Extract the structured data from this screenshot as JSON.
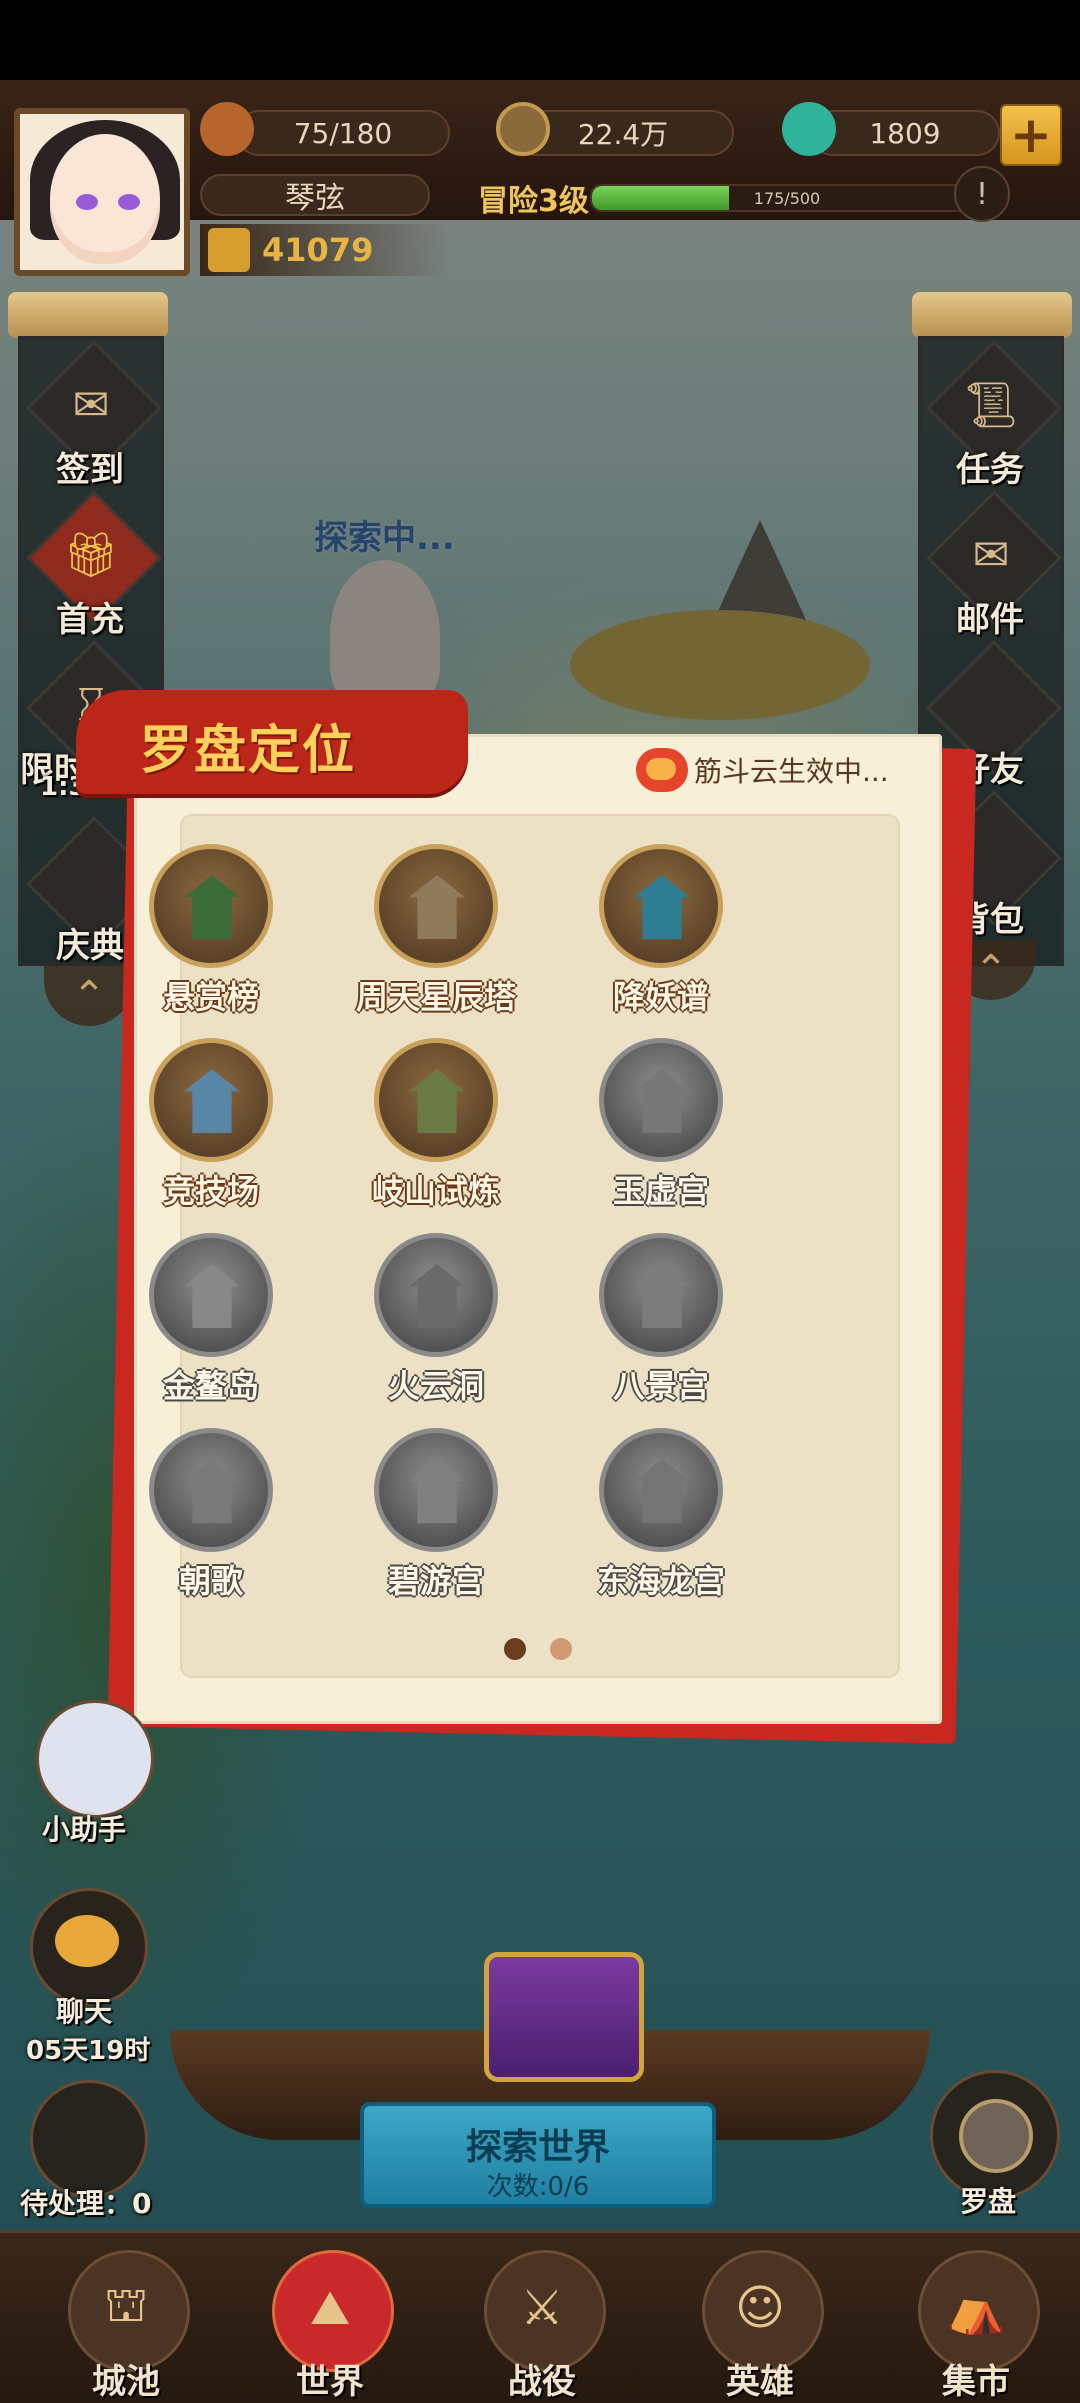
{
  "hud": {
    "stamina": "75/180",
    "coins": "22.4万",
    "gems": "1809",
    "player_name": "琴弦",
    "adventure_level": "冒险3级",
    "xp_text": "175/500",
    "xp_fraction": 0.35,
    "power": "41079"
  },
  "left_menu": [
    {
      "label": "签到"
    },
    {
      "label": "首充"
    },
    {
      "label": "限时",
      "timer": "1:33:"
    },
    {
      "label": "庆典"
    }
  ],
  "right_menu": [
    {
      "label": "任务"
    },
    {
      "label": "邮件"
    },
    {
      "label": "好友"
    },
    {
      "label": "背包"
    }
  ],
  "exploring_status": "探索中...",
  "compass_modal": {
    "title": "罗盘定位",
    "buff": "筋斗云生效中...",
    "locations": [
      {
        "label": "悬赏榜",
        "locked": false
      },
      {
        "label": "周天星辰塔",
        "locked": false
      },
      {
        "label": "降妖谱",
        "locked": false
      },
      {
        "label": "竞技场",
        "locked": false
      },
      {
        "label": "岐山试炼",
        "locked": false
      },
      {
        "label": "玉虚宫",
        "locked": true
      },
      {
        "label": "金鳌岛",
        "locked": true
      },
      {
        "label": "火云洞",
        "locked": true
      },
      {
        "label": "八景宫",
        "locked": true
      },
      {
        "label": "朝歌",
        "locked": true
      },
      {
        "label": "碧游宫",
        "locked": true
      },
      {
        "label": "东海龙宫",
        "locked": true
      }
    ],
    "page_count": 2,
    "current_page": 1
  },
  "lower_left": {
    "helper_label": "小助手",
    "chat_label": "聊天",
    "timer": "05天19时",
    "pending_label": "待处理：0"
  },
  "explore_button": {
    "title": "探索世界",
    "count": "次数:0/6"
  },
  "compass_button_label": "罗盘",
  "bottom_nav": [
    {
      "label": "城池",
      "active": false
    },
    {
      "label": "世界",
      "active": true
    },
    {
      "label": "战役",
      "active": false
    },
    {
      "label": "英雄",
      "active": false
    },
    {
      "label": "集市",
      "active": false
    }
  ],
  "colors": {
    "accent_red": "#c8281f",
    "title_gold": "#ffd15a",
    "explore_blue": "#2a93b5"
  }
}
